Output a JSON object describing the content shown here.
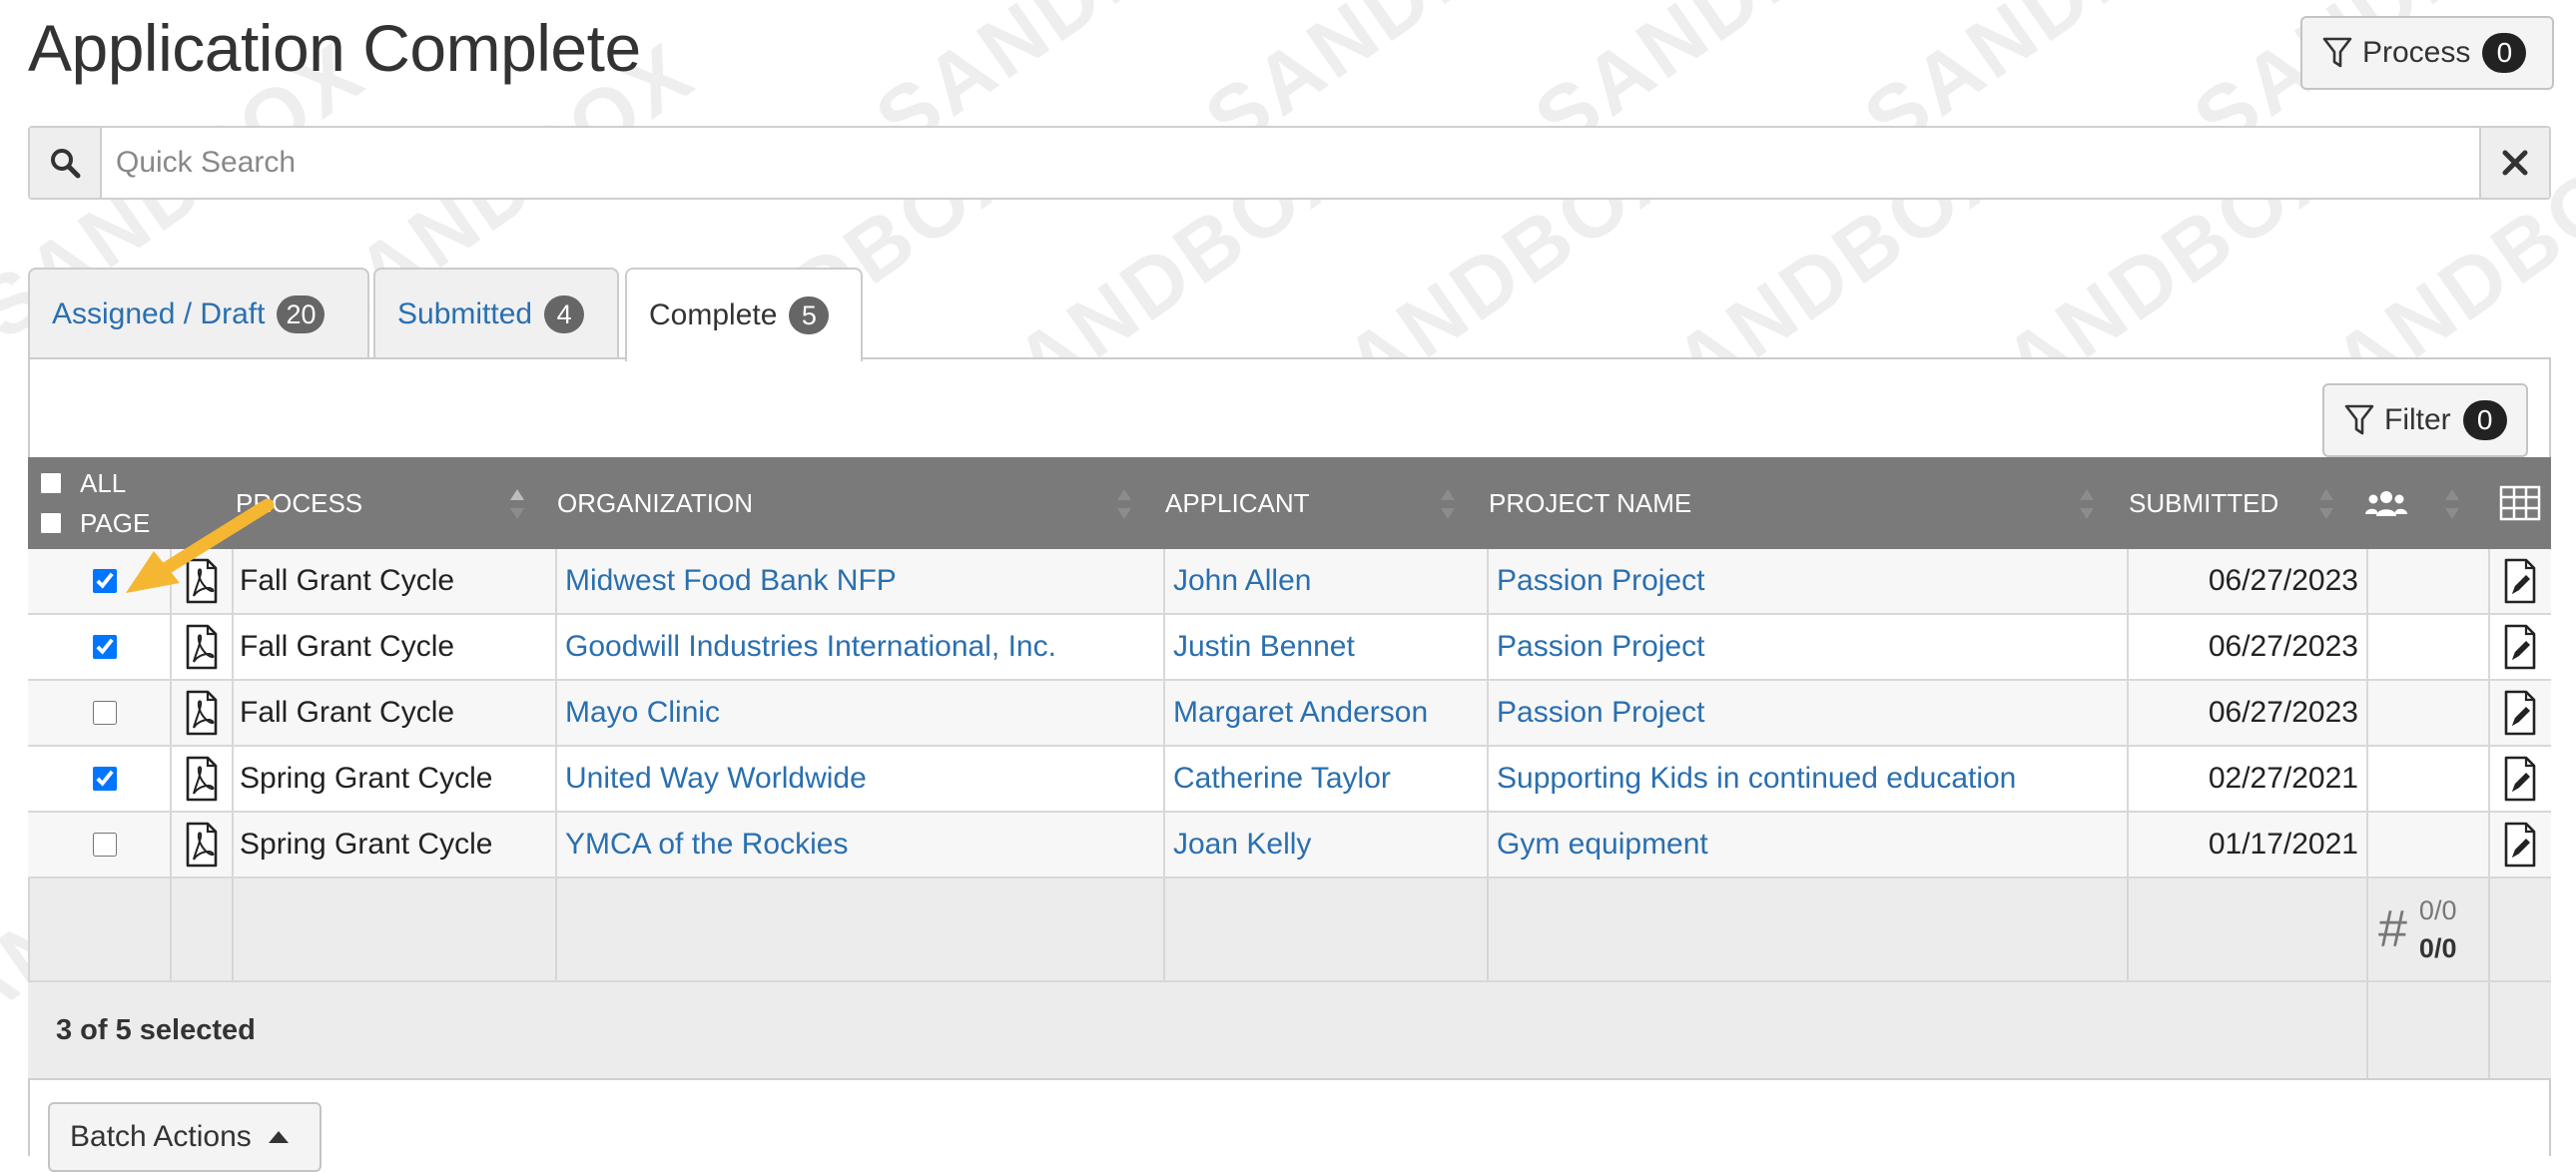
{
  "page": {
    "title": "Application Complete"
  },
  "header": {
    "process_label": "Process",
    "process_count": "0"
  },
  "search": {
    "placeholder": "Quick Search"
  },
  "tabs": [
    {
      "label": "Assigned / Draft",
      "count": "20"
    },
    {
      "label": "Submitted",
      "count": "4"
    },
    {
      "label": "Complete",
      "count": "5"
    }
  ],
  "filter": {
    "label": "Filter",
    "count": "0"
  },
  "table": {
    "select_all_label": "ALL",
    "select_page_label": "PAGE",
    "columns": [
      "PROCESS",
      "ORGANIZATION",
      "APPLICANT",
      "PROJECT NAME",
      "SUBMITTED"
    ],
    "rows": [
      {
        "checked": true,
        "process": "Fall Grant Cycle",
        "organization": "Midwest Food Bank NFP",
        "applicant": "John Allen",
        "project": "Passion Project",
        "submitted": "06/27/2023"
      },
      {
        "checked": true,
        "process": "Fall Grant Cycle",
        "organization": "Goodwill Industries International, Inc.",
        "applicant": "Justin Bennet",
        "project": "Passion Project",
        "submitted": "06/27/2023"
      },
      {
        "checked": false,
        "process": "Fall Grant Cycle",
        "organization": "Mayo Clinic",
        "applicant": "Margaret Anderson",
        "project": "Passion Project",
        "submitted": "06/27/2023"
      },
      {
        "checked": true,
        "process": "Spring Grant Cycle",
        "organization": "United Way Worldwide",
        "applicant": "Catherine Taylor",
        "project": "Supporting Kids in continued education",
        "submitted": "02/27/2021"
      },
      {
        "checked": false,
        "process": "Spring Grant Cycle",
        "organization": "YMCA of the Rockies",
        "applicant": "Joan Kelly",
        "project": "Gym equipment",
        "submitted": "01/17/2021"
      }
    ],
    "footer": {
      "count_top": "0/0",
      "count_bottom": "0/0"
    },
    "selection_summary": "3 of 5 selected"
  },
  "batch": {
    "label": "Batch Actions"
  },
  "watermark": {
    "text": "SANDBOX"
  },
  "colors": {
    "link": "#2a6fb0",
    "header_bg": "#7a7a7a",
    "arrow": "#f5b731",
    "badge_dark": "#222222",
    "tab_badge": "#666666"
  }
}
